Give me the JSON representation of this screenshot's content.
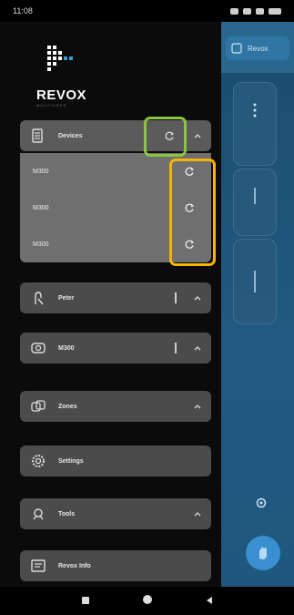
{
  "status_bar": {
    "time": "11:08"
  },
  "brand": {
    "name": "REVOX",
    "tagline": "MULTIUSER"
  },
  "app": {
    "header_label": "Revox"
  },
  "menu": {
    "devices": {
      "label": "Devices",
      "icon": "speaker-icon"
    },
    "device_list": [
      {
        "label": "M300"
      },
      {
        "label": "M300"
      },
      {
        "label": "M300"
      }
    ],
    "peter": {
      "label": "Peter",
      "icon": "person-icon"
    },
    "m300": {
      "label": "M300",
      "icon": "radio-icon"
    },
    "zones": {
      "label": "Zones",
      "icon": "zones-icon"
    },
    "settings": {
      "label": "Settings",
      "icon": "gear-icon"
    },
    "tools": {
      "label": "Tools",
      "icon": "tools-icon"
    },
    "revox_info": {
      "label": "Revox Info",
      "icon": "info-screen-icon"
    }
  },
  "colors": {
    "highlight_green": "#8ac440",
    "highlight_orange": "#f5b400",
    "drawer_bg": "#0b0b0b",
    "item_bg": "#4b4b4b",
    "app_bg": "#215a80"
  }
}
